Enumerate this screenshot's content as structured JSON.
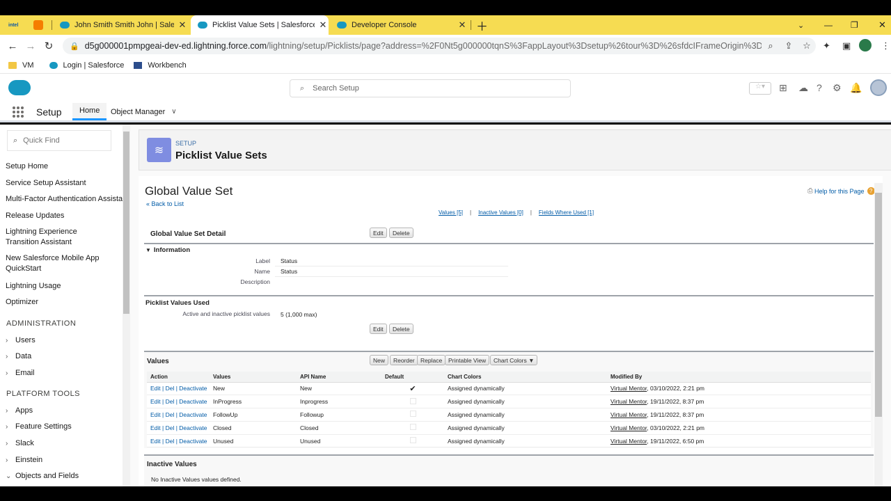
{
  "browser": {
    "tabs": [
      {
        "label": "John Smith Smith John | Salesforce",
        "active": false
      },
      {
        "label": "Picklist Value Sets | Salesforce",
        "active": true
      },
      {
        "label": "Developer Console",
        "active": false
      }
    ],
    "intel_label": "intel",
    "url_host": "d5g000001pmpgeai-dev-ed.lightning.force.com",
    "url_path": "/lightning/setup/Picklists/page?address=%2F0Nt5g000000tqnS%3FappLayout%3Dsetup%26tour%3D%26sfdcIFrameOrigin%3Dhttps%25...",
    "bookmarks": [
      "VM",
      "Login | Salesforce",
      "Workbench"
    ]
  },
  "header": {
    "search_placeholder": "Search Setup"
  },
  "nav": {
    "app_name": "Setup",
    "tab_home": "Home",
    "tab_object_manager": "Object Manager"
  },
  "sidebar": {
    "quick_find_placeholder": "Quick Find",
    "items": [
      "Setup Home",
      "Service Setup Assistant",
      "Multi-Factor Authentication Assistant",
      "Release Updates",
      "Lightning Experience Transition Assistant",
      "New Salesforce Mobile App QuickStart",
      "Lightning Usage",
      "Optimizer"
    ],
    "section_admin": "ADMINISTRATION",
    "admin_items": [
      "Users",
      "Data",
      "Email"
    ],
    "section_platform": "PLATFORM TOOLS",
    "platform_items": [
      "Apps",
      "Feature Settings",
      "Slack",
      "Einstein",
      "Objects and Fields"
    ]
  },
  "page": {
    "kicker": "SETUP",
    "title": "Picklist Value Sets",
    "heading": "Global Value Set",
    "back_link": "« Back to List",
    "help_link": "Help for this Page",
    "related_links": [
      "Values [5]",
      "Inactive Values [0]",
      "Fields Where Used [1]"
    ],
    "detail_title": "Global Value Set Detail",
    "edit": "Edit",
    "delete": "Delete",
    "info_section": "Information",
    "fields": {
      "label_label": "Label",
      "label_value": "Status",
      "name_label": "Name",
      "name_value": "Status",
      "description_label": "Description",
      "description_value": ""
    },
    "used_section": "Picklist Values Used",
    "used_label": "Active and inactive picklist values",
    "used_value": "5 (1,000 max)",
    "values_section": "Values",
    "values_buttons": {
      "new": "New",
      "reorder": "Reorder",
      "replace": "Replace",
      "printable": "Printable View",
      "chart_colors": "Chart Colors ▼"
    },
    "columns": [
      "Action",
      "Values",
      "API Name",
      "Default",
      "Chart Colors",
      "Modified By"
    ],
    "action_links": {
      "edit": "Edit",
      "del": "Del",
      "deactivate": "Deactivate"
    },
    "rows": [
      {
        "value": "New",
        "api": "New",
        "default": true,
        "color": "Assigned dynamically",
        "user": "Virtual Mentor",
        "date": ", 03/10/2022, 2:21 pm"
      },
      {
        "value": "InProgress",
        "api": "Inprogress",
        "default": false,
        "color": "Assigned dynamically",
        "user": "Virtual Mentor",
        "date": ", 19/11/2022, 8:37 pm"
      },
      {
        "value": "FollowUp",
        "api": "Followup",
        "default": false,
        "color": "Assigned dynamically",
        "user": "Virtual Mentor",
        "date": ", 19/11/2022, 8:37 pm"
      },
      {
        "value": "Closed",
        "api": "Closed",
        "default": false,
        "color": "Assigned dynamically",
        "user": "Virtual Mentor",
        "date": ", 03/10/2022, 2:21 pm"
      },
      {
        "value": "Unused",
        "api": "Unused",
        "default": false,
        "color": "Assigned dynamically",
        "user": "Virtual Mentor",
        "date": ", 19/11/2022, 6:50 pm"
      }
    ],
    "inactive_section": "Inactive Values",
    "inactive_message": "No Inactive Values values defined."
  },
  "colors": {
    "tabstrip": "#f6dc52",
    "salesforce_blue": "#1798c1",
    "link_blue": "#015ba7",
    "setup_icon": "#7f8de1"
  }
}
